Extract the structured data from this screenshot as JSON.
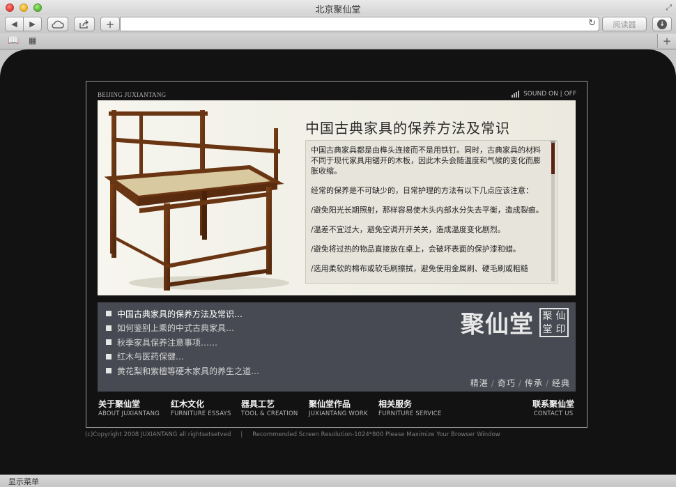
{
  "browser": {
    "window_title": "北京聚仙堂",
    "reader_label": "阅读器",
    "status_text": "显示菜单"
  },
  "page": {
    "brand": "BEIJING JUXIANTANG",
    "sound_label": "SOUND ON | OFF",
    "article": {
      "title": "中国古典家具的保养方法及常识",
      "paragraphs": [
        "中国古典家具都是由榫头连接而不是用铁钉。同时，古典家具的材料不同于现代家具用锯开的木板，因此木头会随温度和气候的变化而膨胀收缩。",
        "经常的保养是不可缺少的，日常护理的方法有以下几点应该注意：",
        "/避免阳光长期照射，那样容易使木头内部水分失去平衡，造成裂痕。",
        "/温差不宜过大，避免空调开开关关，造成温度变化剧烈。",
        "/避免将过热的物品直接放在桌上，会破坏表面的保护漆和蜡。",
        "/选用柔软的棉布或软毛刷擦拭，避免使用金属刷、硬毛刷或粗糙"
      ]
    },
    "article_links": [
      "中国古典家具的保养方法及常识…",
      "如何鉴别上乘的中式古典家具…",
      "秋季家具保养注意事项……",
      "红木与医药保健…",
      "黄花梨和紫檀等硬木家具的养生之道…"
    ],
    "logo_text": "聚仙堂",
    "seal_chars": [
      "聚",
      "仙",
      "堂",
      "印"
    ],
    "slogan": [
      "精湛",
      "奇巧",
      "传承",
      "经典"
    ],
    "slogan_separator": "/",
    "nav": [
      {
        "cn": "关于聚仙堂",
        "en": "ABOUT JUXIANTANG"
      },
      {
        "cn": "红木文化",
        "en": "FURNITURE ESSAYS"
      },
      {
        "cn": "器具工艺",
        "en": "TOOL & CREATION"
      },
      {
        "cn": "聚仙堂作品",
        "en": "JUXIANTANG WORK"
      },
      {
        "cn": "相关服务",
        "en": "FURNITURE SERVICE"
      },
      {
        "cn": "联系聚仙堂",
        "en": "CONTACT US"
      }
    ],
    "copyright": "(c)Copyright 2008 JUXIANTANG all rightsetsetved",
    "copyright_sep": "|",
    "resolution_note": "Recommended Screen Resolution-1024*800  Please Maximize Your Browser Window"
  },
  "colors": {
    "page_bg": "#121212",
    "hero_bg": "#f2f1e8",
    "panel_bg": "#474a52",
    "scroll_thumb": "#5a2214"
  }
}
